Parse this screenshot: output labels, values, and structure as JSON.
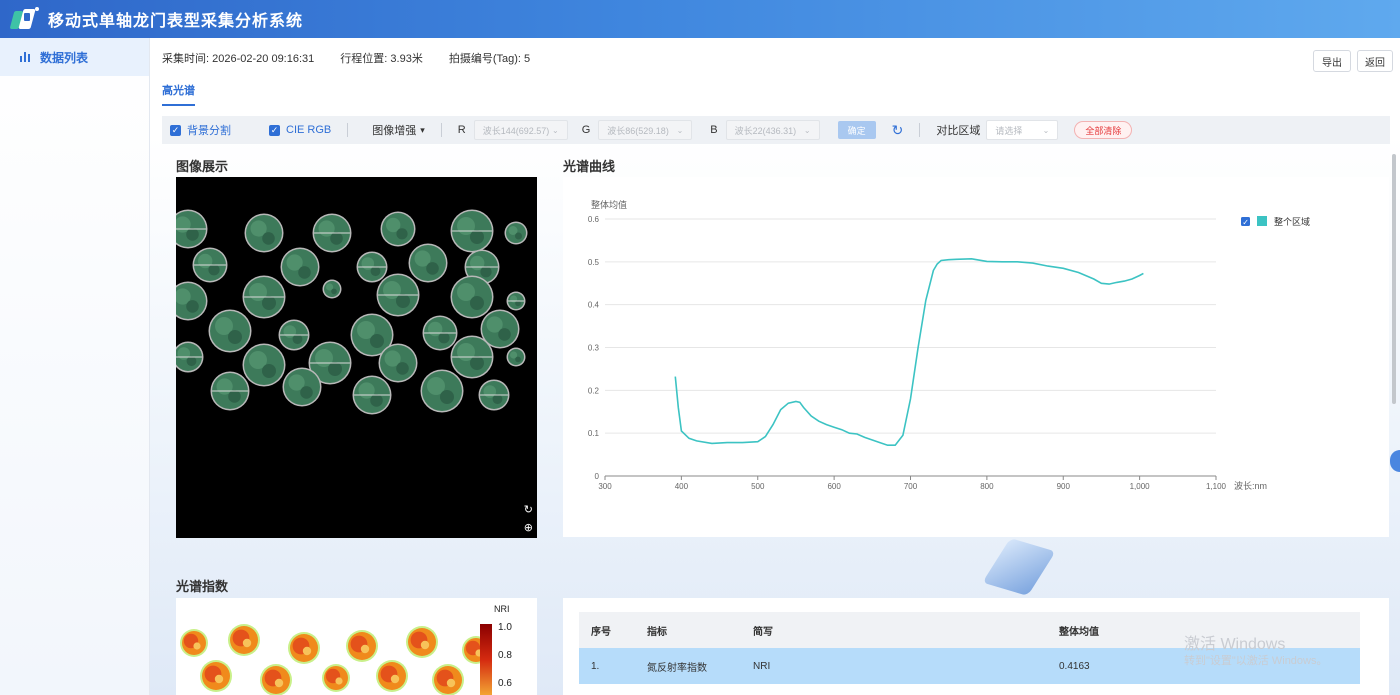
{
  "header": {
    "title": "移动式单轴龙门表型采集分析系统"
  },
  "sidebar": {
    "items": [
      {
        "label": "数据列表"
      }
    ]
  },
  "info": {
    "time_label": "采集时间:",
    "time_value": "2026-02-20 09:16:31",
    "position_label": "行程位置:",
    "position_value": "3.93米",
    "tag_label": "拍摄编号(Tag):",
    "tag_value": "5"
  },
  "buttons": {
    "export": "导出",
    "back": "返回",
    "confirm": "确定",
    "clear_all": "全部清除"
  },
  "tabs": [
    {
      "label": "高光谱",
      "active": true
    }
  ],
  "toolbar": {
    "background_seg": "背景分割",
    "cie_rgb": "CIE RGB",
    "enhance": "图像增强",
    "r_label": "R",
    "r_value": "波长144(692.57)",
    "g_label": "G",
    "g_value": "波长86(529.18)",
    "b_label": "B",
    "b_value": "波长22(436.31)",
    "compare_label": "对比区域",
    "compare_placeholder": "请选择"
  },
  "sections": {
    "image": "图像展示",
    "curve": "光谱曲线",
    "index": "光谱指数"
  },
  "chart_data": {
    "type": "line",
    "ylabel": "整体均值",
    "xlabel": "波长:nm",
    "xlim": [
      300,
      1100
    ],
    "ylim": [
      0,
      0.6
    ],
    "xticks": [
      "300",
      "400",
      "500",
      "600",
      "700",
      "800",
      "900",
      "1,000",
      "1,100"
    ],
    "yticks": [
      "0",
      "0.1",
      "0.2",
      "0.3",
      "0.4",
      "0.5",
      "0.6"
    ],
    "legend_position": "top-right",
    "grid": true,
    "series": [
      {
        "name": "整个区域",
        "color": "#3cc3c3",
        "x": [
          392,
          396,
          400,
          410,
          420,
          440,
          460,
          480,
          500,
          510,
          520,
          530,
          540,
          550,
          555,
          560,
          570,
          580,
          590,
          600,
          610,
          620,
          630,
          640,
          650,
          660,
          670,
          680,
          690,
          700,
          710,
          720,
          730,
          735,
          740,
          750,
          760,
          780,
          800,
          820,
          840,
          860,
          880,
          900,
          920,
          940,
          950,
          960,
          970,
          980,
          990,
          1000,
          1005
        ],
        "values": [
          0.232,
          0.16,
          0.105,
          0.088,
          0.082,
          0.076,
          0.078,
          0.078,
          0.08,
          0.092,
          0.12,
          0.155,
          0.17,
          0.174,
          0.172,
          0.16,
          0.14,
          0.128,
          0.12,
          0.114,
          0.108,
          0.1,
          0.098,
          0.09,
          0.084,
          0.078,
          0.072,
          0.072,
          0.095,
          0.18,
          0.3,
          0.41,
          0.48,
          0.495,
          0.503,
          0.505,
          0.506,
          0.507,
          0.501,
          0.5,
          0.5,
          0.497,
          0.49,
          0.485,
          0.475,
          0.46,
          0.45,
          0.448,
          0.452,
          0.455,
          0.46,
          0.468,
          0.473
        ]
      }
    ]
  },
  "index_legend": {
    "title": "NRI",
    "ticks": [
      "1.0",
      "0.8",
      "0.6"
    ]
  },
  "table": {
    "headers": [
      "序号",
      "指标",
      "简写",
      "整体均值"
    ],
    "rows": [
      {
        "no": "1.",
        "name": "氮反射率指数",
        "abbr": "NRI",
        "mean": "0.4163"
      }
    ]
  },
  "watermark": {
    "line1": "激活 Windows",
    "line2": "转到\"设置\"以激活 Windows。"
  }
}
